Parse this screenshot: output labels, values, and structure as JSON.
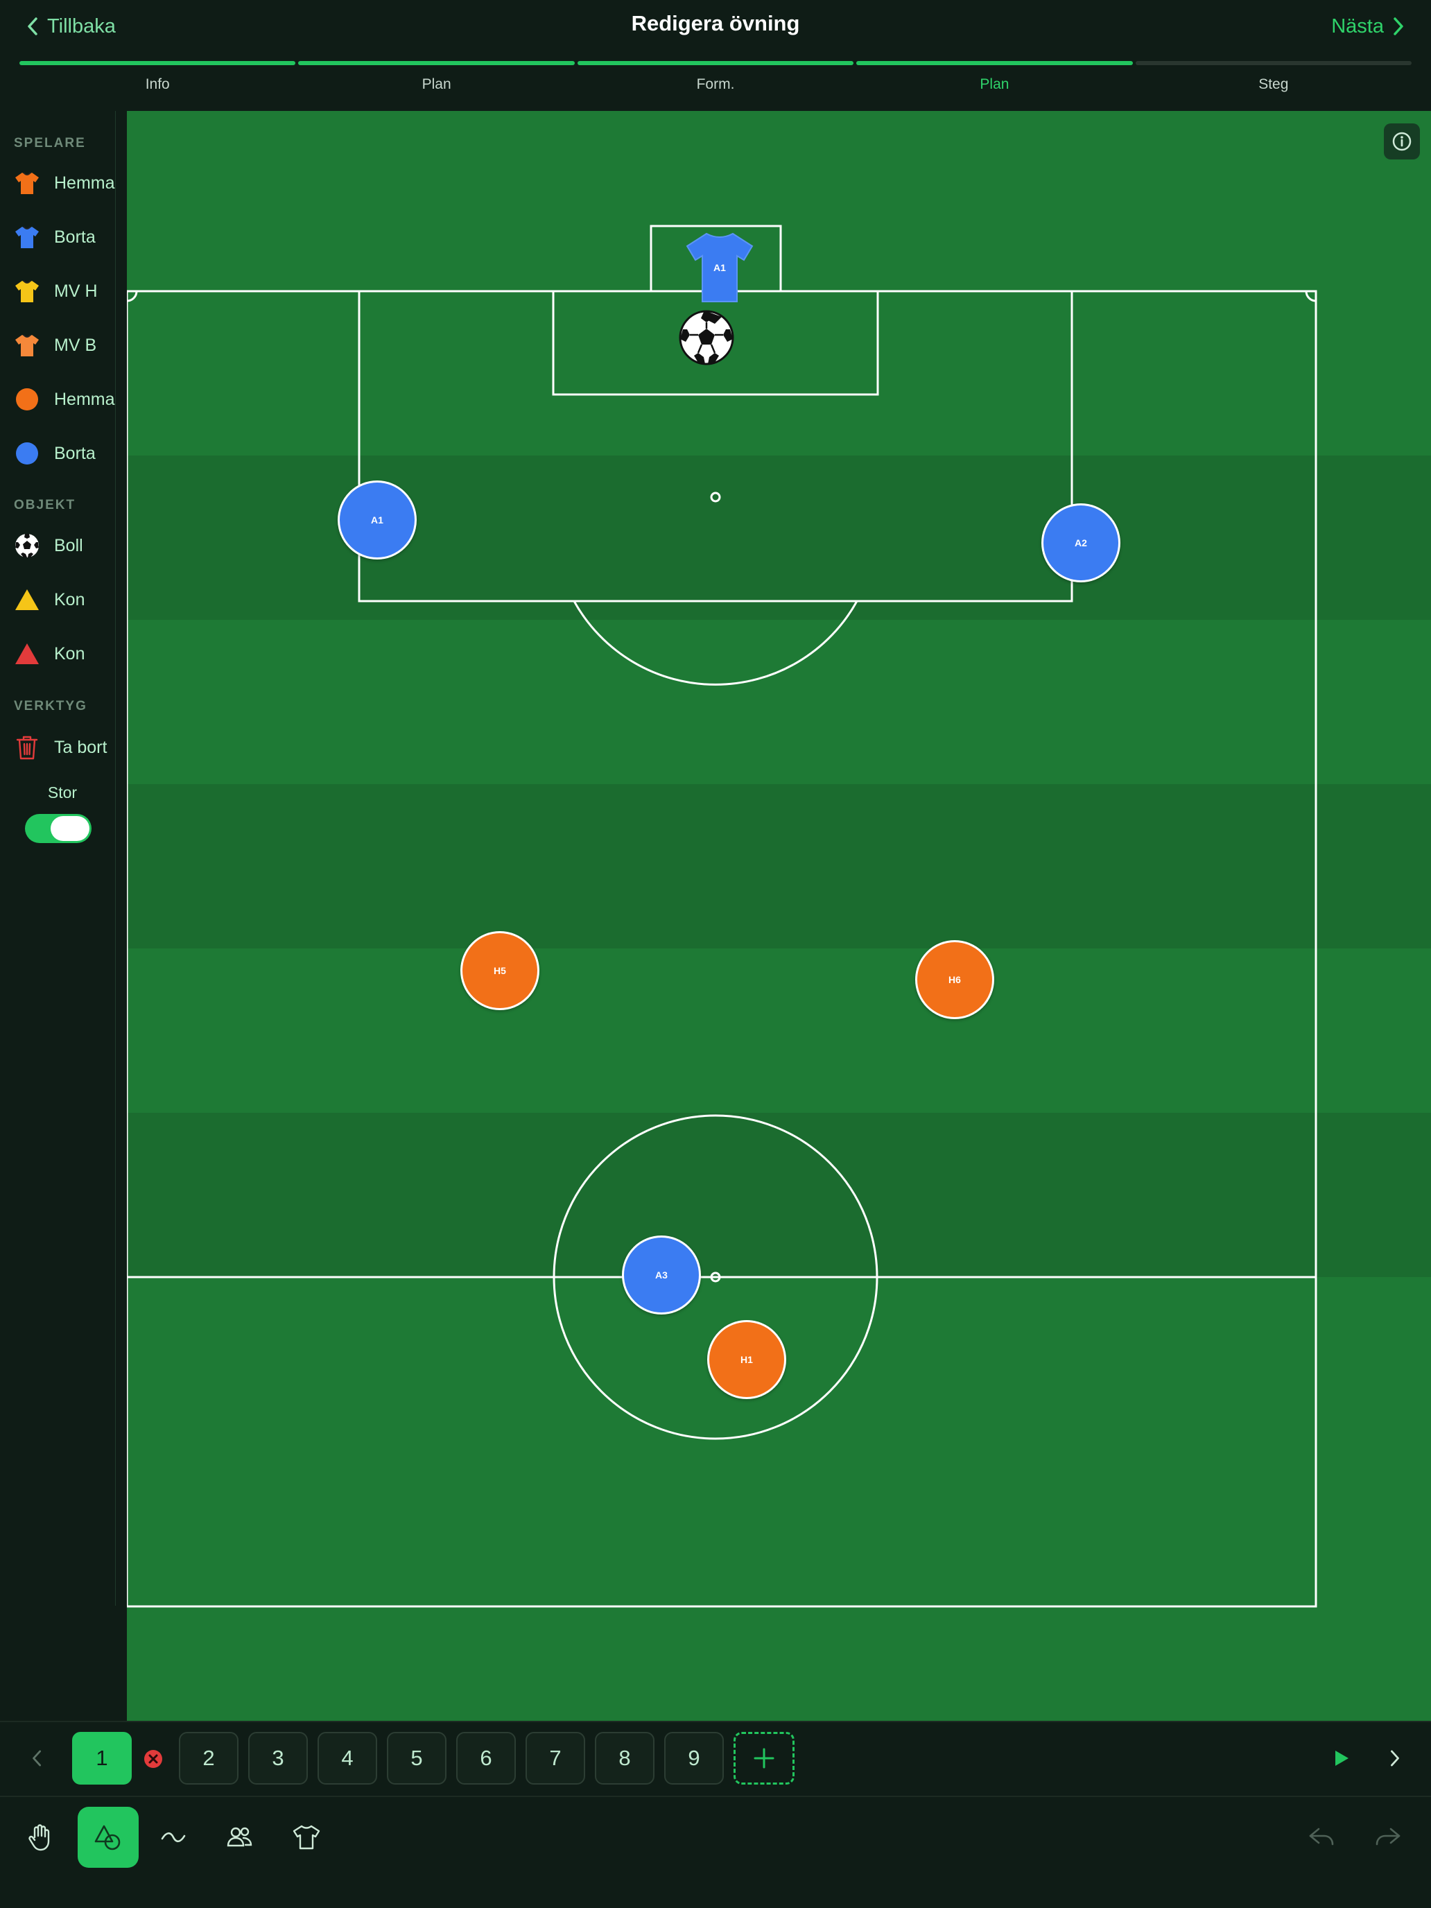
{
  "header": {
    "back_label": "Tillbaka",
    "title": "Redigera övning",
    "next_label": "Nästa"
  },
  "steps": [
    {
      "label": "Info",
      "state": "done"
    },
    {
      "label": "Plan",
      "state": "done"
    },
    {
      "label": "Form.",
      "state": "done"
    },
    {
      "label": "Plan",
      "state": "current"
    },
    {
      "label": "Steg",
      "state": "pending"
    }
  ],
  "sidebar": {
    "players_heading": "SPELARE",
    "players": [
      {
        "label": "Hemma",
        "icon": "jersey-icon",
        "color": "#f27018"
      },
      {
        "label": "Borta",
        "icon": "jersey-icon",
        "color": "#3b7cf2"
      },
      {
        "label": "MV H",
        "icon": "jersey-icon",
        "color": "#f5c518"
      },
      {
        "label": "MV B",
        "icon": "jersey-icon",
        "color": "#f5883a"
      },
      {
        "label": "Hemma",
        "icon": "circle-icon",
        "color": "#f27018"
      },
      {
        "label": "Borta",
        "icon": "circle-icon",
        "color": "#3b7cf2"
      }
    ],
    "objects_heading": "OBJEKT",
    "objects": [
      {
        "label": "Boll",
        "icon": "ball-icon"
      },
      {
        "label": "Kon",
        "icon": "cone-icon",
        "color": "#f5c518"
      },
      {
        "label": "Kon",
        "icon": "cone-icon",
        "color": "#e23b3b"
      }
    ],
    "tools_heading": "VERKTYG",
    "tools": [
      {
        "label": "Ta bort",
        "icon": "trash-icon",
        "color": "#e23b3b"
      }
    ],
    "size_label": "Stor",
    "size_toggle_on": true
  },
  "field": {
    "colors": {
      "grass_light": "#1e7a35",
      "grass_dark": "#1b6c2f",
      "lines": "#ffffff"
    },
    "tokens": [
      {
        "label": "A1",
        "team": "away"
      },
      {
        "label": "A2",
        "team": "away"
      },
      {
        "label": "H5",
        "team": "home"
      },
      {
        "label": "H6",
        "team": "home"
      },
      {
        "label": "A3",
        "team": "away"
      },
      {
        "label": "H1",
        "team": "home"
      }
    ],
    "keeper": {
      "label": "A1",
      "team": "away",
      "icon": "jersey-icon"
    },
    "ball_icon": "soccer-ball-icon"
  },
  "frames": {
    "items": [
      "1",
      "2",
      "3",
      "4",
      "5",
      "6",
      "7",
      "8",
      "9"
    ],
    "active": "1"
  },
  "toolbar": {
    "tools": [
      {
        "name": "hand-tool",
        "icon": "hand-icon",
        "active": false
      },
      {
        "name": "shapes-tool",
        "icon": "shapes-icon",
        "active": true
      },
      {
        "name": "line-tool",
        "icon": "wave-icon",
        "active": false
      },
      {
        "name": "players-tool",
        "icon": "people-icon",
        "active": false
      },
      {
        "name": "jersey-tool",
        "icon": "jersey-icon",
        "active": false
      }
    ],
    "accent": "#22c55e"
  }
}
